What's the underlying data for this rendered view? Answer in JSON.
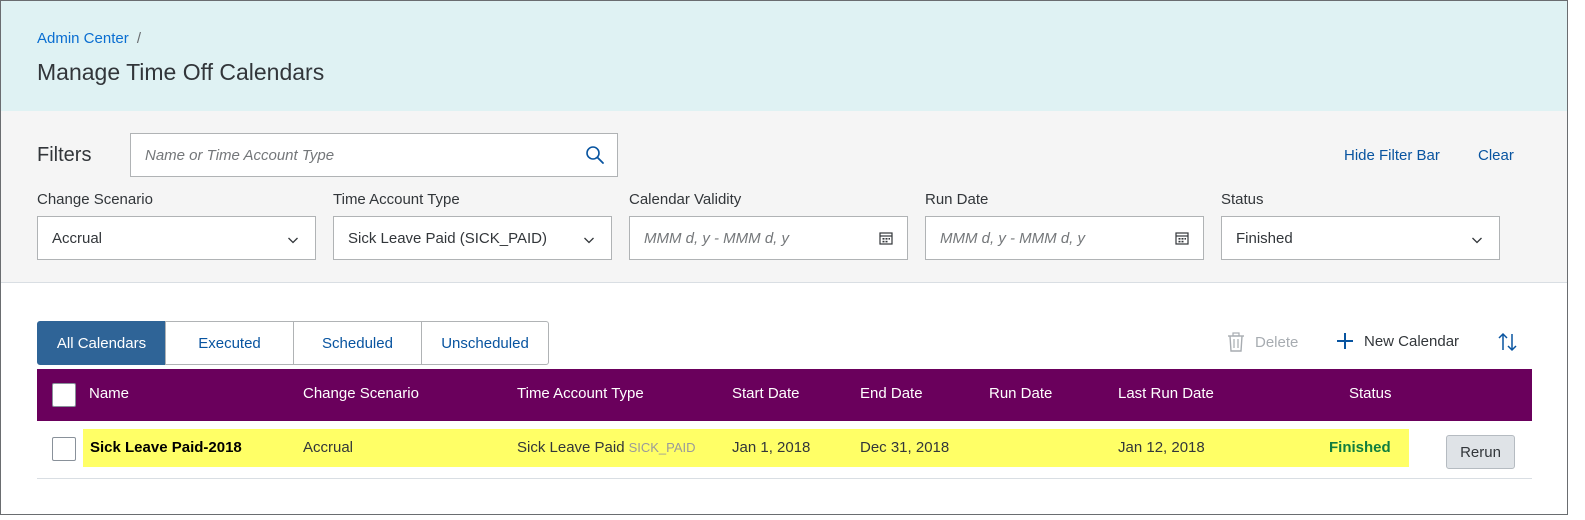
{
  "breadcrumb": {
    "link": "Admin Center",
    "separator": "/"
  },
  "page_title": "Manage Time Off Calendars",
  "filters": {
    "label": "Filters",
    "search_placeholder": "Name or Time Account Type",
    "hide_filter_bar": "Hide Filter Bar",
    "clear": "Clear",
    "change_scenario": {
      "label": "Change Scenario",
      "value": "Accrual"
    },
    "time_account_type": {
      "label": "Time Account Type",
      "value": "Sick Leave Paid (SICK_PAID)"
    },
    "calendar_validity": {
      "label": "Calendar Validity",
      "placeholder": "MMM d, y - MMM d, y"
    },
    "run_date": {
      "label": "Run Date",
      "placeholder": "MMM d, y - MMM d, y"
    },
    "status": {
      "label": "Status",
      "value": "Finished"
    }
  },
  "tabs": [
    "All Calendars",
    "Executed",
    "Scheduled",
    "Unscheduled"
  ],
  "toolbar": {
    "delete": "Delete",
    "new_calendar": "New Calendar"
  },
  "table": {
    "columns": [
      "Name",
      "Change Scenario",
      "Time Account Type",
      "Start Date",
      "End Date",
      "Run Date",
      "Last Run Date",
      "Status"
    ],
    "rows": [
      {
        "name": "Sick Leave Paid-2018",
        "change_scenario": "Accrual",
        "time_account_type": "Sick Leave Paid",
        "time_account_code": "SICK_PAID",
        "start_date": "Jan 1, 2018",
        "end_date": "Dec 31, 2018",
        "run_date": "",
        "last_run_date": "Jan 12, 2018",
        "status": "Finished",
        "action": "Rerun"
      }
    ]
  },
  "colors": {
    "header_bg": "#dff2f3",
    "table_header_bg": "#6a005c",
    "active_tab_bg": "#2f6497",
    "row_highlight": "#ffff66",
    "status_success": "#107e3e"
  }
}
